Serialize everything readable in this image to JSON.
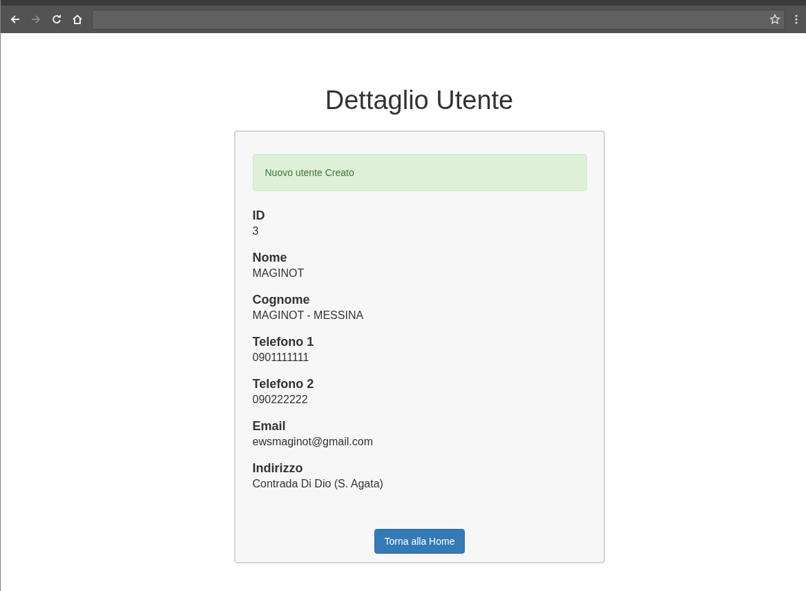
{
  "browser": {
    "nav_buttons": [
      {
        "kind": "back",
        "disabled": false
      },
      {
        "kind": "forward",
        "disabled": true
      },
      {
        "kind": "reload",
        "disabled": false
      },
      {
        "kind": "home",
        "disabled": false
      }
    ]
  },
  "page": {
    "title": "Dettaglio Utente",
    "alert": "Nuovo utente Creato",
    "fields": [
      {
        "label": "ID",
        "value": "3"
      },
      {
        "label": "Nome",
        "value": "MAGINOT"
      },
      {
        "label": "Cognome",
        "value": "MAGINOT - MESSINA"
      },
      {
        "label": "Telefono 1",
        "value": "0901111111"
      },
      {
        "label": "Telefono 2",
        "value": "090222222"
      },
      {
        "label": "Email",
        "value": "ewsmaginot@gmail.com"
      },
      {
        "label": "Indirizzo",
        "value": "Contrada Di Dio (S. Agata)"
      }
    ],
    "button": "Torna alla Home"
  }
}
